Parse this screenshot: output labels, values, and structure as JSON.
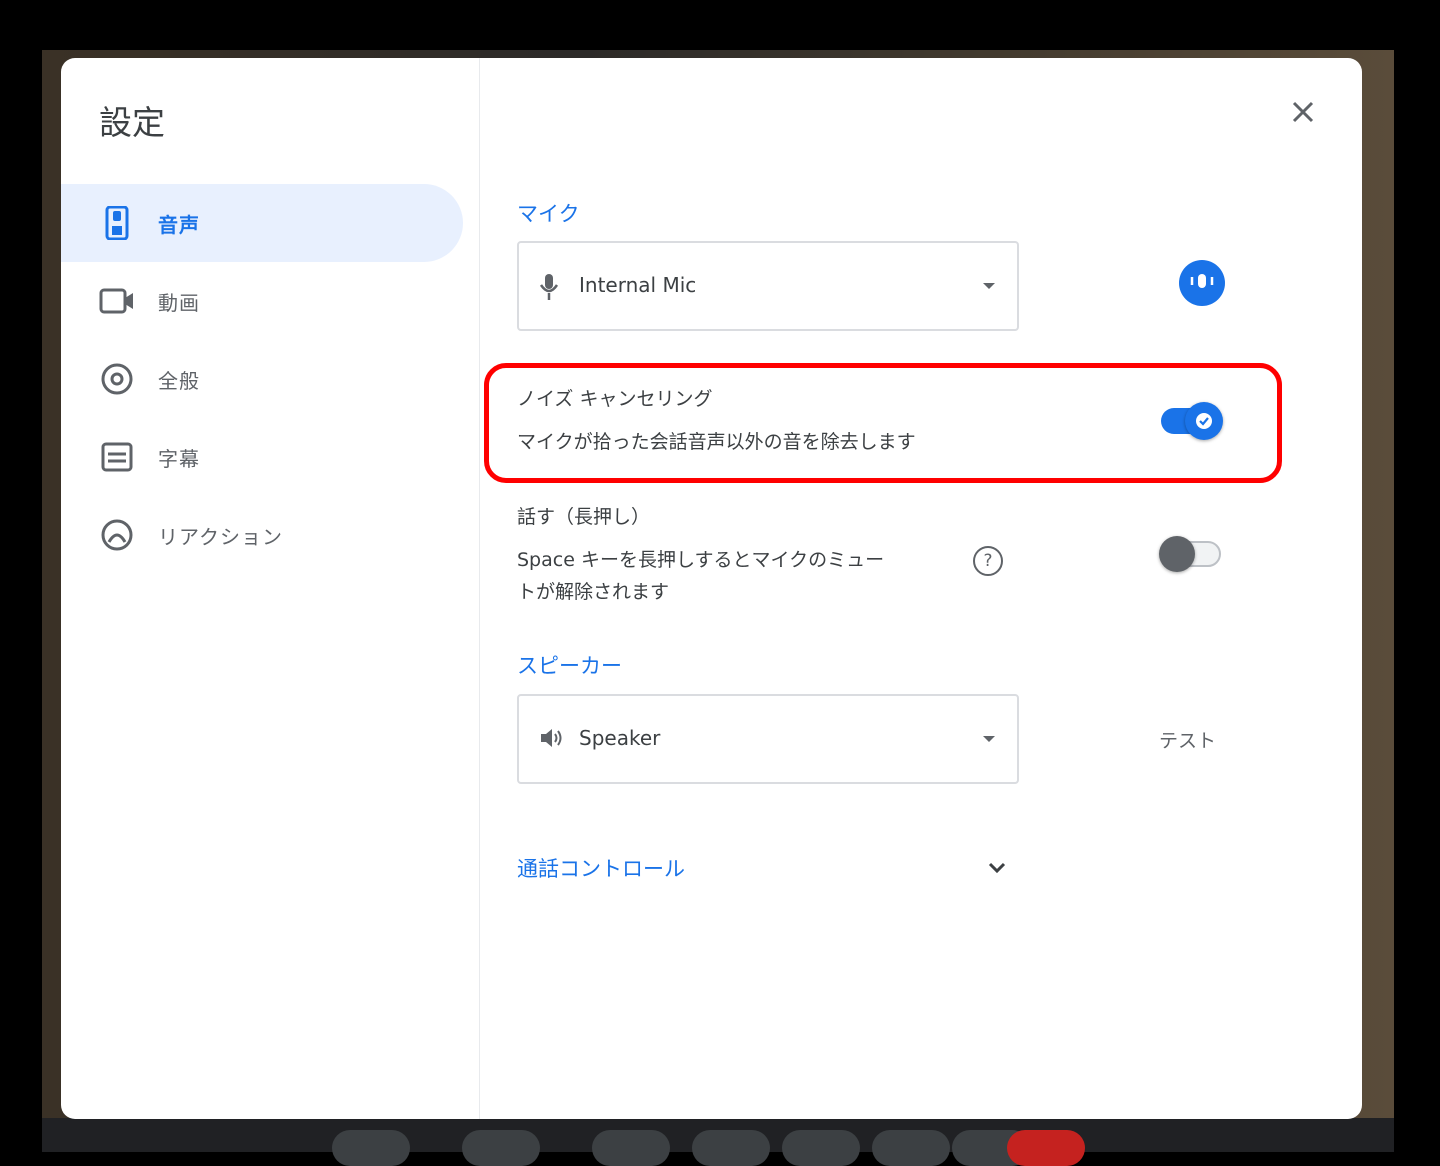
{
  "dialog": {
    "title": "設定",
    "close_icon": "close-icon"
  },
  "sidebar": {
    "items": [
      {
        "label": "音声",
        "icon": "audio-icon",
        "active": true
      },
      {
        "label": "動画",
        "icon": "video-icon",
        "active": false
      },
      {
        "label": "全般",
        "icon": "gear-icon",
        "active": false
      },
      {
        "label": "字幕",
        "icon": "captions-icon",
        "active": false
      },
      {
        "label": "リアクション",
        "icon": "reactions-icon",
        "active": false
      }
    ]
  },
  "microphone": {
    "section_label": "マイク",
    "selected": "Internal Mic",
    "icon": "mic-icon",
    "test_icon": "mic-test-icon"
  },
  "noise_cancellation": {
    "title": "ノイズ キャンセリング",
    "description": "マイクが拾った会話音声以外の音を除去します",
    "enabled": true
  },
  "push_to_talk": {
    "title": "話す（長押し）",
    "description_line1": "Space キーを長押しするとマイクのミュー",
    "description_line2": "トが解除されます",
    "help_icon_text": "?",
    "enabled": false
  },
  "speaker": {
    "section_label": "スピーカー",
    "selected": "Speaker",
    "icon": "speaker-icon",
    "test_label": "テスト"
  },
  "call_controls": {
    "label": "通話コントロール",
    "icon": "chevron-down-icon"
  },
  "colors": {
    "accent": "#1a73e8",
    "highlight": "#ff0000",
    "active_nav_bg": "#e8f0fe"
  }
}
